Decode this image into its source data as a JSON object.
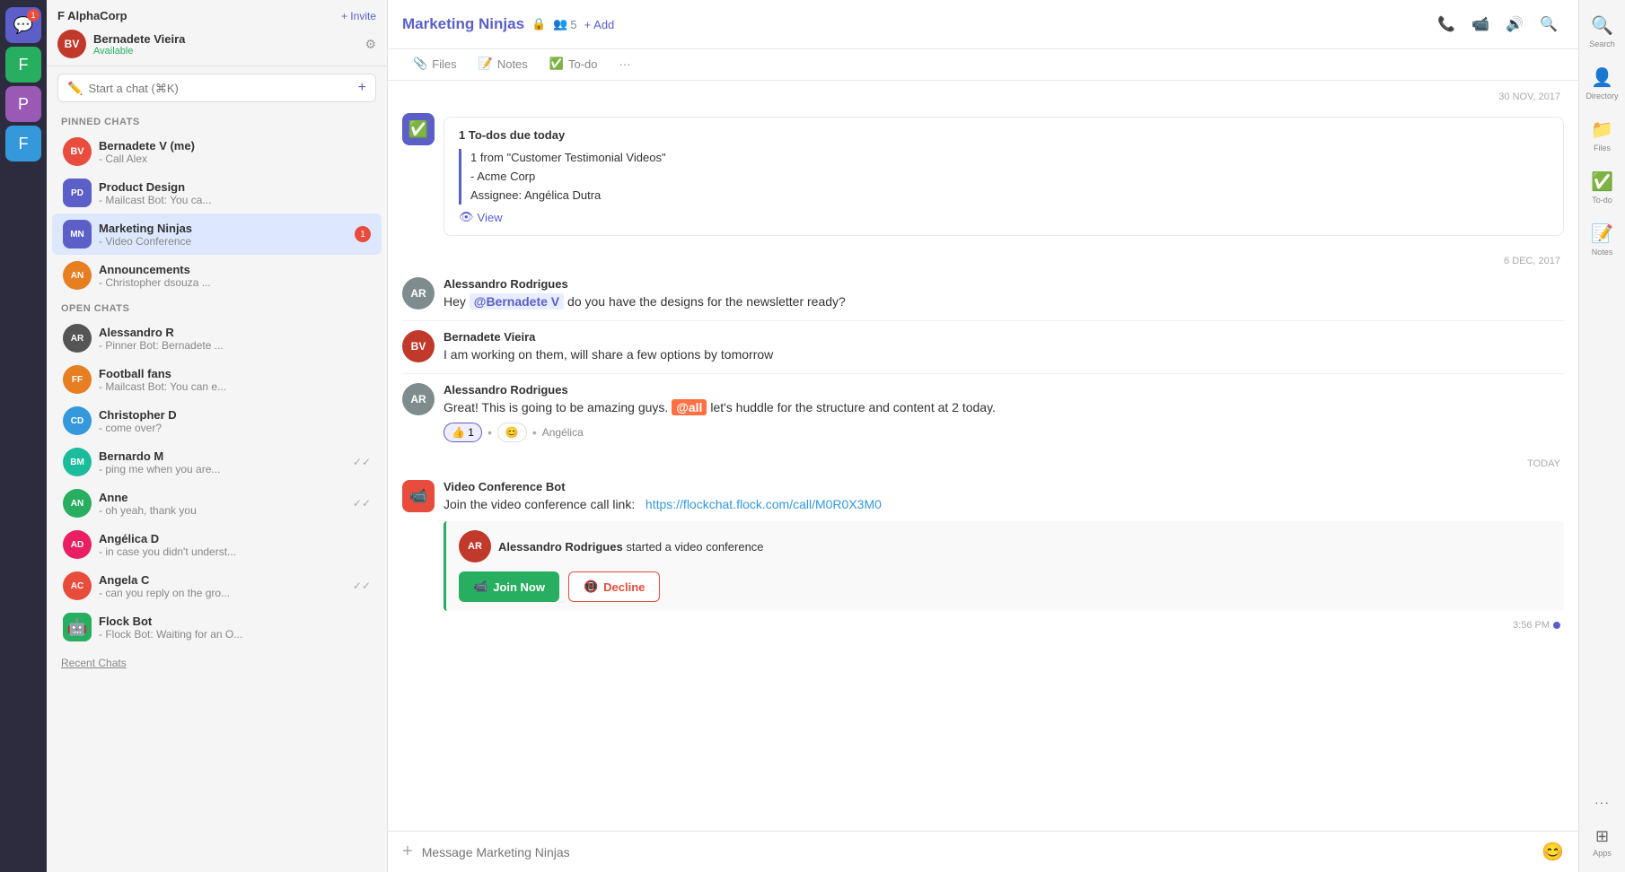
{
  "iconBar": {
    "items": [
      {
        "name": "chat-icon",
        "symbol": "💬",
        "active": true,
        "badge": "1"
      },
      {
        "name": "workspace-f-icon",
        "symbol": "F",
        "active": false,
        "color": "green"
      },
      {
        "name": "workspace-p-icon",
        "symbol": "P",
        "active": false,
        "color": "purple"
      },
      {
        "name": "workspace-f2-icon",
        "symbol": "F",
        "active": false,
        "color": "blue"
      }
    ]
  },
  "sidebar": {
    "workspaceName": "F AlphaCorp",
    "inviteLabel": "+ Invite",
    "user": {
      "name": "Bernadete Vieira",
      "status": "Available"
    },
    "searchPlaceholder": "Start a chat (⌘K)",
    "pinnedLabel": "PINNED CHATS",
    "pinnedChats": [
      {
        "name": "Bernadete V (me)",
        "preview": " - Call Alex",
        "avatarText": "BV",
        "avatarColor": "red"
      },
      {
        "name": "Product Design",
        "preview": " - Mailcast Bot: You ca...",
        "avatarText": "PD",
        "avatarColor": "group"
      },
      {
        "name": "Marketing Ninjas",
        "preview": " - Video Conference",
        "avatarText": "MN",
        "avatarColor": "group",
        "active": true,
        "badge": "1"
      },
      {
        "name": "Announcements",
        "preview": " - Christopher dsouza ...",
        "avatarText": "AN",
        "avatarColor": "orange"
      }
    ],
    "openLabel": "OPEN CHATS",
    "openChats": [
      {
        "name": "Alessandro R",
        "preview": " - Pinner Bot: Bernadete ...",
        "avatarText": "AR",
        "avatarColor": "dark"
      },
      {
        "name": "Football fans",
        "preview": " - Mailcast Bot: You can e...",
        "avatarText": "FF",
        "avatarColor": "orange"
      },
      {
        "name": "Christopher D",
        "preview": " - come over?",
        "avatarText": "CD",
        "avatarColor": "blue"
      },
      {
        "name": "Bernardo M",
        "preview": " - ping me when you are...",
        "avatarText": "BM",
        "avatarColor": "teal",
        "check": true
      },
      {
        "name": "Anne",
        "preview": " - oh yeah, thank you",
        "avatarText": "AN",
        "avatarColor": "green",
        "check": true
      },
      {
        "name": "Angélica D",
        "preview": " - in case you didn't underst...",
        "avatarText": "AD",
        "avatarColor": "pink"
      },
      {
        "name": "Angela C",
        "preview": " - can you reply on the gro...",
        "avatarText": "AC",
        "avatarColor": "red",
        "check": true
      },
      {
        "name": "Flock Bot",
        "preview": " - Flock Bot: Waiting for an O...",
        "avatarText": "🤖",
        "avatarColor": "green"
      }
    ],
    "recentChatsLabel": "Recent Chats"
  },
  "chatHeader": {
    "title": "Marketing Ninjas",
    "lockIcon": "🔒",
    "membersCount": "5",
    "addLabel": "+ Add",
    "tabs": [
      {
        "label": "Files",
        "icon": "📎",
        "active": false
      },
      {
        "label": "Notes",
        "icon": "📝",
        "active": false
      },
      {
        "label": "To-do",
        "icon": "✅",
        "active": false
      },
      {
        "label": "...",
        "icon": "",
        "active": false
      }
    ],
    "headerActions": {
      "phone": "📞",
      "video": "📹",
      "audio": "🔊",
      "search": "🔍"
    }
  },
  "messages": {
    "date1": "30 NOV, 2017",
    "date2": "6 DEC, 2017",
    "dateToday": "TODAY",
    "msg1": {
      "type": "todo",
      "title": "1 To-dos due today",
      "items": [
        "1 from \"Customer Testimonial Videos\"",
        "- Acme Corp",
        "Assignee: Angélica Dutra"
      ],
      "viewLabel": "View"
    },
    "msg2": {
      "sender": "Alessandro Rodrigues",
      "text1": "Hey ",
      "mention": "@Bernadete V",
      "text2": " do you have the designs for the newsletter ready?"
    },
    "msg3": {
      "sender": "Bernadete Vieira",
      "text": "I am working on them, will share a few options by tomorrow"
    },
    "msg4": {
      "sender": "Alessandro Rodrigues",
      "text1": "Great! This is going to be amazing guys. ",
      "mentionAll": "@all",
      "text2": " let's huddle for the structure and content at 2 today.",
      "reactions": [
        {
          "emoji": "👍",
          "count": "1",
          "active": true
        },
        {
          "emoji": "😊",
          "count": "",
          "active": false,
          "dot": true
        },
        {
          "label": "Angélica"
        }
      ]
    },
    "videoBotMsg": {
      "botName": "Video Conference Bot",
      "text": "Join the video conference call link:  ",
      "link": "https://flockchat.flock.com/call/M0R0X3M0",
      "card": {
        "starterName": "Alessandro Rodrigues",
        "action": "started a video conference",
        "joinLabel": "Join Now",
        "declineLabel": "Decline"
      }
    },
    "msgTime": "3:56 PM"
  },
  "messageInput": {
    "placeholder": "Message Marketing Ninjas"
  },
  "rightPanel": {
    "items": [
      {
        "name": "search-panel",
        "icon": "🔍",
        "label": "Search"
      },
      {
        "name": "directory-panel",
        "icon": "👤",
        "label": "Directory"
      },
      {
        "name": "files-panel",
        "icon": "📁",
        "label": "Files"
      },
      {
        "name": "todo-panel",
        "icon": "✅",
        "label": "To-do"
      },
      {
        "name": "notes-panel",
        "icon": "📝",
        "label": "Notes"
      },
      {
        "name": "more-panel",
        "icon": "···",
        "label": ""
      },
      {
        "name": "apps-panel",
        "icon": "⊞",
        "label": "Apps"
      }
    ]
  }
}
